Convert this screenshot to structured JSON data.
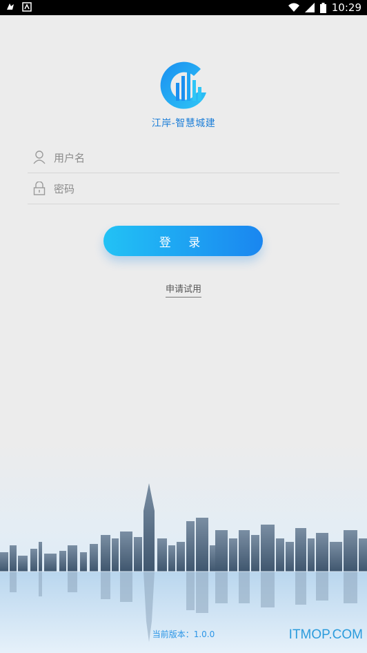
{
  "status_bar": {
    "time": "10:29",
    "battery_icon": "battery-icon",
    "signal_icon": "signal-icon",
    "wifi_icon": "wifi-icon"
  },
  "brand": {
    "name": "江岸-智慧城建",
    "logo_icon": "city-logo-icon"
  },
  "login_form": {
    "username_placeholder": "用户名",
    "password_placeholder": "密码",
    "login_label": "登 录",
    "trial_label": "申请试用"
  },
  "footer": {
    "version_text": "当前版本：1.0.0",
    "watermark": "ITMOP.COM"
  },
  "colors": {
    "accent": "#1e7fd8",
    "button_start": "#22c2f5",
    "button_end": "#1a86f0"
  }
}
